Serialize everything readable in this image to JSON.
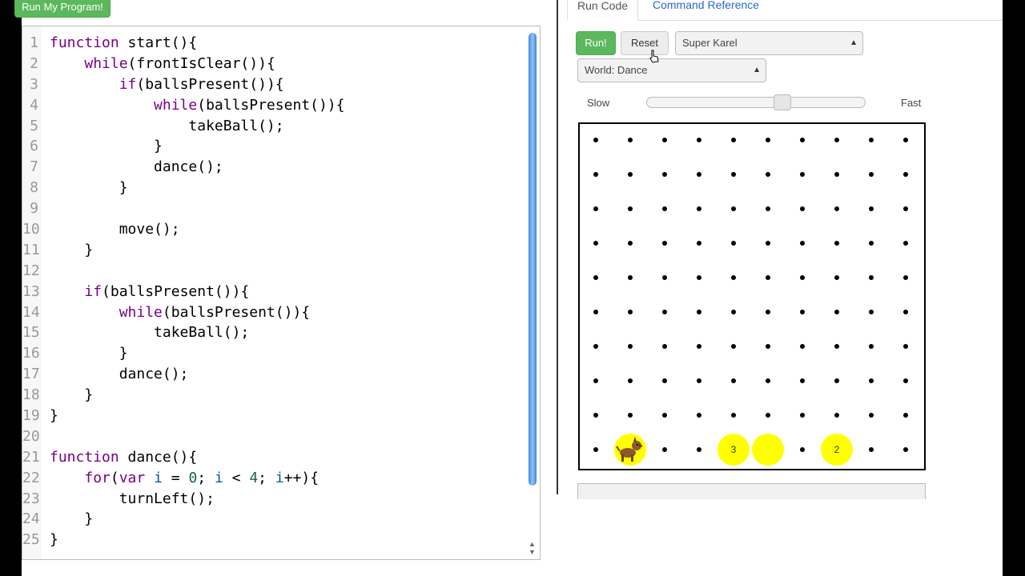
{
  "top_button": "Run My Program!",
  "editor": {
    "line_numbers": [
      "1",
      "2",
      "3",
      "4",
      "5",
      "6",
      "7",
      "8",
      "9",
      "10",
      "11",
      "12",
      "13",
      "14",
      "15",
      "16",
      "17",
      "18",
      "19",
      "20",
      "21",
      "22",
      "23",
      "24",
      "25"
    ]
  },
  "tabs": {
    "run_code": "Run Code",
    "command_reference": "Command Reference"
  },
  "controls": {
    "run_label": "Run!",
    "reset_label": "Reset",
    "karel_select": "Super Karel",
    "world_select": "World: Dance",
    "speed_slow": "Slow",
    "speed_fast": "Fast",
    "speed_value": 0.6
  },
  "world": {
    "cols": 10,
    "rows": 10,
    "karel": {
      "col": 2,
      "row": 1,
      "facing": "east"
    },
    "balls": [
      {
        "col": 2,
        "row": 1,
        "count": ""
      },
      {
        "col": 5,
        "row": 1,
        "count": "3"
      },
      {
        "col": 6,
        "row": 1,
        "count": ""
      },
      {
        "col": 8,
        "row": 1,
        "count": "2"
      }
    ]
  },
  "colors": {
    "run_green": "#5cb85c",
    "ball_yellow": "#ffff00",
    "keyword": "#770088"
  }
}
